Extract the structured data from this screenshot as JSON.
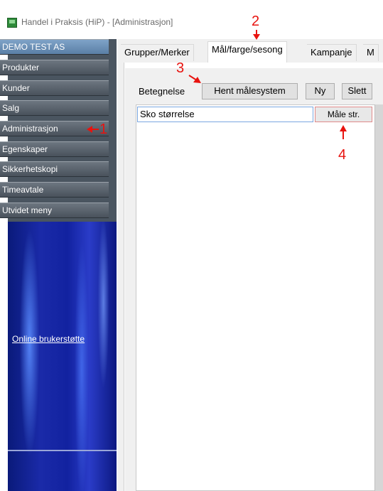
{
  "window": {
    "title": "Handel i Praksis (HiP) - [Administrasjon]"
  },
  "sidebar": {
    "company": "DEMO TEST AS",
    "items": [
      {
        "label": "Produkter"
      },
      {
        "label": "Kunder"
      },
      {
        "label": "Salg"
      },
      {
        "label": "Administrasjon"
      },
      {
        "label": "Egenskaper"
      },
      {
        "label": "Sikkerhetskopi"
      },
      {
        "label": "Timeavtale"
      },
      {
        "label": "Utvidet meny"
      }
    ],
    "support_link": "Online brukerstøtte"
  },
  "tabs": [
    {
      "label": "Grupper/Merker",
      "active": false
    },
    {
      "label": "Mål/farge/sesong",
      "active": true
    },
    {
      "label": "Kampanje",
      "active": false
    },
    {
      "label": "M",
      "active": false
    }
  ],
  "toolbar": {
    "label": "Betegnelse",
    "fetch_button": "Hent målesystem",
    "new_button": "Ny",
    "delete_button": "Slett"
  },
  "grid": {
    "rows": [
      {
        "name": "Sko størrelse",
        "action": "Måle str."
      }
    ]
  },
  "annotations": {
    "marker_1": "1",
    "marker_2": "2",
    "marker_3": "3",
    "marker_4": "4",
    "color": "#e8130f"
  },
  "colors": {
    "sidebar_bg": "#4a5560",
    "company_bg": "#6f94bb",
    "panel_blue": "#1a2aa8",
    "selection_border": "#7aa7e0"
  }
}
